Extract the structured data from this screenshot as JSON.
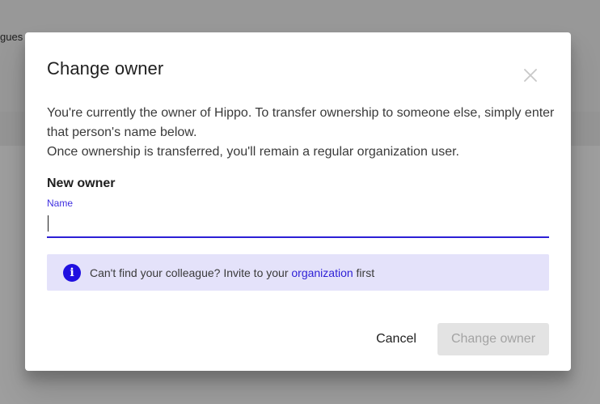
{
  "background": {
    "text_fragment": "gues"
  },
  "dialog": {
    "title": "Change owner",
    "close_icon": "close-icon",
    "description": {
      "line1": "You're currently the owner of Hippo. To transfer ownership to someone else, simply enter that person's name below.",
      "line2": "Once ownership is transferred, you'll remain a regular organization user."
    },
    "section_label": "New owner",
    "field": {
      "label": "Name",
      "value": ""
    },
    "info": {
      "icon": "info-icon",
      "text_before": "Can't find your colleague? Invite to your ",
      "link": "organization",
      "text_after": " first"
    },
    "cancel_label": "Cancel",
    "confirm_label": "Change owner"
  },
  "colors": {
    "accent": "#2d1fd6",
    "info_background": "#e4e2fa",
    "disabled_button": "#e3e3e3",
    "disabled_text": "#a3a3a3"
  }
}
